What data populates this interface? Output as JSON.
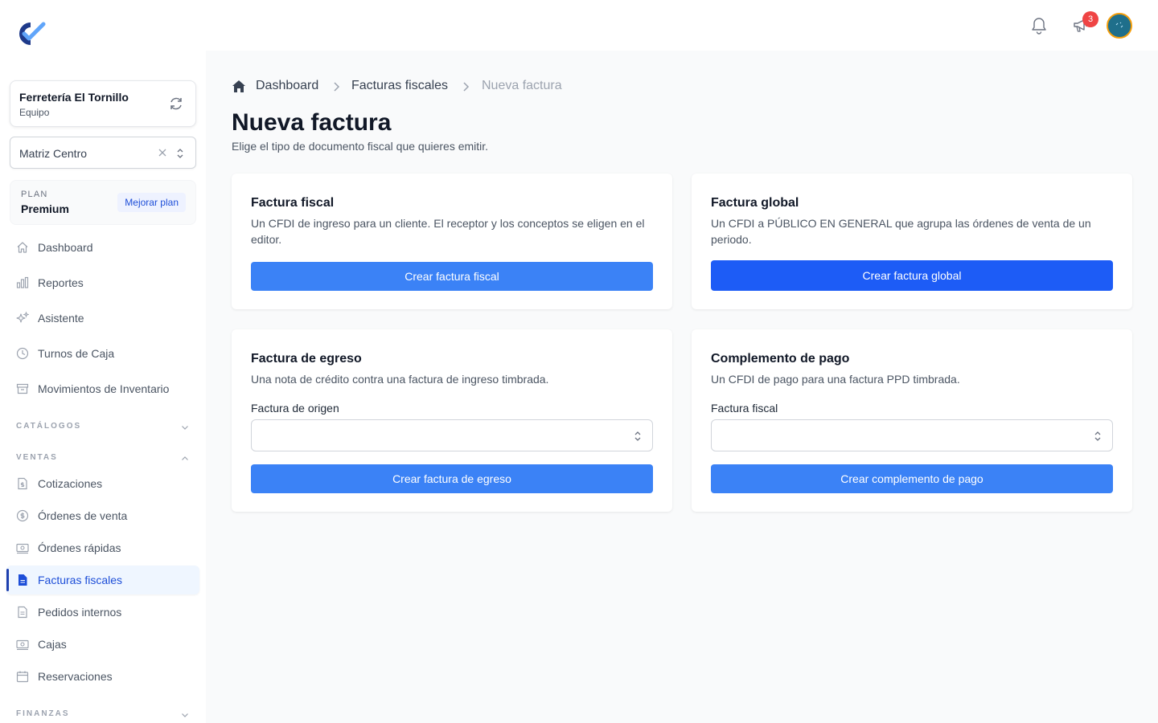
{
  "sidebar": {
    "team": {
      "name": "Ferretería El Tornillo",
      "subtitle": "Equipo"
    },
    "branch": {
      "value": "Matriz Centro"
    },
    "plan": {
      "label": "PLAN",
      "name": "Premium",
      "upgrade_label": "Mejorar plan"
    },
    "main_nav": [
      {
        "label": "Dashboard",
        "icon": "home-icon"
      },
      {
        "label": "Reportes",
        "icon": "chart-bar-icon"
      },
      {
        "label": "Asistente",
        "icon": "sparkles-icon"
      },
      {
        "label": "Turnos de Caja",
        "icon": "clock-icon"
      },
      {
        "label": "Movimientos de Inventario",
        "icon": "archive-box-icon"
      }
    ],
    "sections": {
      "catalogos": "CATÁLOGOS",
      "ventas": "VENTAS",
      "finanzas": "FINANZAS"
    },
    "ventas_items": [
      {
        "label": "Cotizaciones",
        "icon": "document-currency-icon"
      },
      {
        "label": "Órdenes de venta",
        "icon": "currency-dollar-icon"
      },
      {
        "label": "Órdenes rápidas",
        "icon": "banknotes-icon"
      },
      {
        "label": "Facturas fiscales",
        "icon": "document-text-icon",
        "active": true
      },
      {
        "label": "Pedidos internos",
        "icon": "document-icon"
      },
      {
        "label": "Cajas",
        "icon": "cash-register-icon"
      },
      {
        "label": "Reservaciones",
        "icon": "calendar-icon"
      }
    ]
  },
  "topbar": {
    "notification_count": "3"
  },
  "breadcrumb": [
    "Dashboard",
    "Facturas fiscales",
    "Nueva factura"
  ],
  "page": {
    "title": "Nueva factura",
    "subtitle": "Elige el tipo de documento fiscal que quieres emitir."
  },
  "cards": {
    "fiscal": {
      "title": "Factura fiscal",
      "description": "Un CFDI de ingreso para un cliente. El receptor y los conceptos se eligen en el editor.",
      "button": "Crear factura fiscal"
    },
    "global": {
      "title": "Factura global",
      "description": "Un CFDI a PÚBLICO EN GENERAL que agrupa las órdenes de venta de un periodo.",
      "button": "Crear factura global"
    },
    "egreso": {
      "title": "Factura de egreso",
      "description": "Una nota de crédito contra una factura de ingreso timbrada.",
      "field_label": "Factura de origen",
      "button": "Crear factura de egreso"
    },
    "pago": {
      "title": "Complemento de pago",
      "description": "Un CFDI de pago para una factura PPD timbrada.",
      "field_label": "Factura fiscal",
      "button": "Crear complemento de pago"
    }
  },
  "colors": {
    "primary": "#3b82f6",
    "primary_strong": "#1d5cf6",
    "active_nav": "#1d4ed8",
    "badge": "#ef4444"
  }
}
